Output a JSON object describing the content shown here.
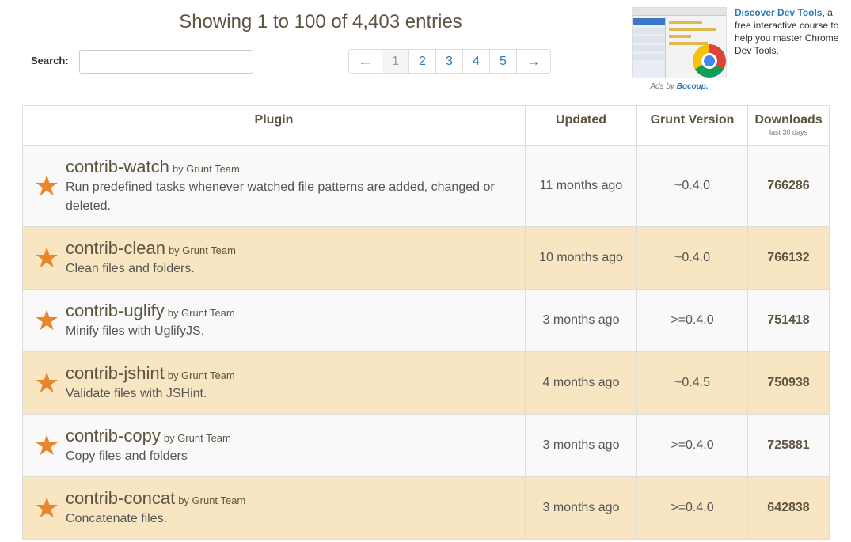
{
  "header": {
    "entries_text": "Showing 1 to 100 of 4,403 entries",
    "search_label": "Search:",
    "search_value": "",
    "search_placeholder": ""
  },
  "pagination": {
    "prev": "←",
    "pages": [
      "1",
      "2",
      "3",
      "4",
      "5"
    ],
    "active_page": "1",
    "next": "→"
  },
  "ad": {
    "link_text": "Discover Dev Tools",
    "body_text": ", a free interactive course to help you master Chrome Dev Tools.",
    "ads_by": "Ads by",
    "sponsor": "Bocoup."
  },
  "table": {
    "headers": {
      "plugin": "Plugin",
      "updated": "Updated",
      "grunt_version": "Grunt Version",
      "downloads": "Downloads",
      "downloads_sub": "last 30 days"
    },
    "rows": [
      {
        "name": "contrib-watch",
        "by": "by Grunt Team",
        "desc": "Run predefined tasks whenever watched file patterns are added, changed or deleted.",
        "updated": "11 months ago",
        "grunt": "~0.4.0",
        "downloads": "766286"
      },
      {
        "name": "contrib-clean",
        "by": "by Grunt Team",
        "desc": "Clean files and folders.",
        "updated": "10 months ago",
        "grunt": "~0.4.0",
        "downloads": "766132"
      },
      {
        "name": "contrib-uglify",
        "by": "by Grunt Team",
        "desc": "Minify files with UglifyJS.",
        "updated": "3 months ago",
        "grunt": ">=0.4.0",
        "downloads": "751418"
      },
      {
        "name": "contrib-jshint",
        "by": "by Grunt Team",
        "desc": "Validate files with JSHint.",
        "updated": "4 months ago",
        "grunt": "~0.4.5",
        "downloads": "750938"
      },
      {
        "name": "contrib-copy",
        "by": "by Grunt Team",
        "desc": "Copy files and folders",
        "updated": "3 months ago",
        "grunt": ">=0.4.0",
        "downloads": "725881"
      },
      {
        "name": "contrib-concat",
        "by": "by Grunt Team",
        "desc": "Concatenate files.",
        "updated": "3 months ago",
        "grunt": ">=0.4.0",
        "downloads": "642838"
      }
    ]
  },
  "colors": {
    "accent_star": "#e8852d",
    "row_highlight": "#f8e5c2",
    "link": "#2a7ab5"
  },
  "icons": {
    "row_icon": "star-icon"
  }
}
